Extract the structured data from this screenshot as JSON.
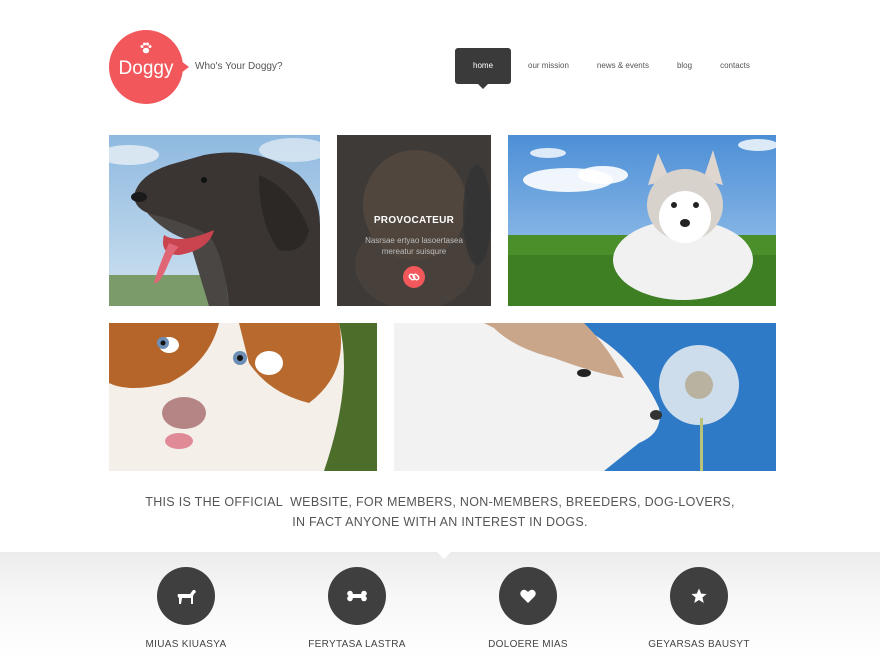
{
  "header": {
    "logo_text": "Doggy",
    "logo_icon": "paw-icon",
    "tagline": "Who's Your Doggy?"
  },
  "nav": {
    "items": [
      {
        "label": "home",
        "active": true
      },
      {
        "label": "our mission",
        "active": false
      },
      {
        "label": "news & events",
        "active": false
      },
      {
        "label": "blog",
        "active": false
      },
      {
        "label": "contacts",
        "active": false
      }
    ]
  },
  "gallery": {
    "overlay": {
      "title": "PROVOCATEUR",
      "text": "Nasrsae ertyao lasoertasea mereatur suisqure",
      "icon": "link-icon"
    }
  },
  "intro": {
    "line1": "THIS IS THE OFFICIAL  WEBSITE, FOR MEMBERS, NON-MEMBERS, BREEDERS, DOG-LOVERS,",
    "line2": "IN FACT ANYONE WITH AN INTEREST IN DOGS."
  },
  "features": [
    {
      "label": "MIUAS KIUASYA",
      "icon": "dog-icon"
    },
    {
      "label": "FERYTASA LASTRA",
      "icon": "bone-icon"
    },
    {
      "label": "DOLOERE MIAS",
      "icon": "heart-icon"
    },
    {
      "label": "GEYARSAS BAUSYT",
      "icon": "star-icon"
    }
  ],
  "colors": {
    "accent": "#f2585b",
    "dark": "#3a3a3a"
  }
}
